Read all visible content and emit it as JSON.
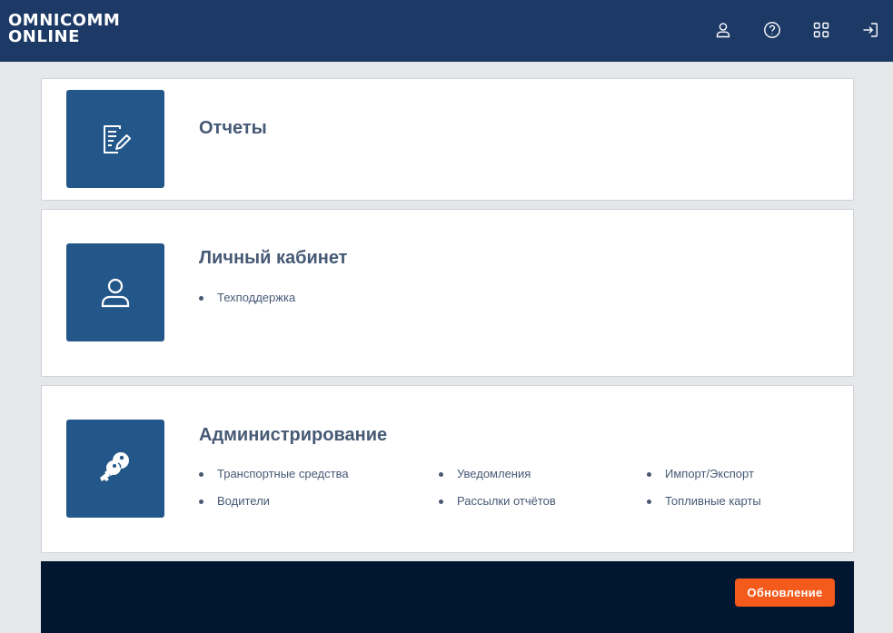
{
  "header": {
    "logo_line1": "OMNICOMM",
    "logo_line2": "ONLINE",
    "icons": [
      "user-icon",
      "help-icon",
      "apps-grid-icon",
      "logout-icon"
    ]
  },
  "cards": {
    "reports": {
      "title": "Отчеты",
      "icon": "report-edit-icon"
    },
    "account": {
      "title": "Личный кабинет",
      "icon": "user-icon",
      "links": [
        "Техподдержка"
      ]
    },
    "admin": {
      "title": "Администрирование",
      "icon": "keys-icon",
      "links": [
        "Транспортные средства",
        "Уведомления",
        "Импорт/Экспорт",
        "Водители",
        "Рассылки отчётов",
        "Топливные карты"
      ]
    }
  },
  "footer": {
    "update_label": "Обновление"
  },
  "colors": {
    "header_bg": "#1d3a66",
    "tile_bg": "#245789",
    "text": "#465975",
    "footer_bg": "#001631",
    "accent": "#f35a1b"
  }
}
